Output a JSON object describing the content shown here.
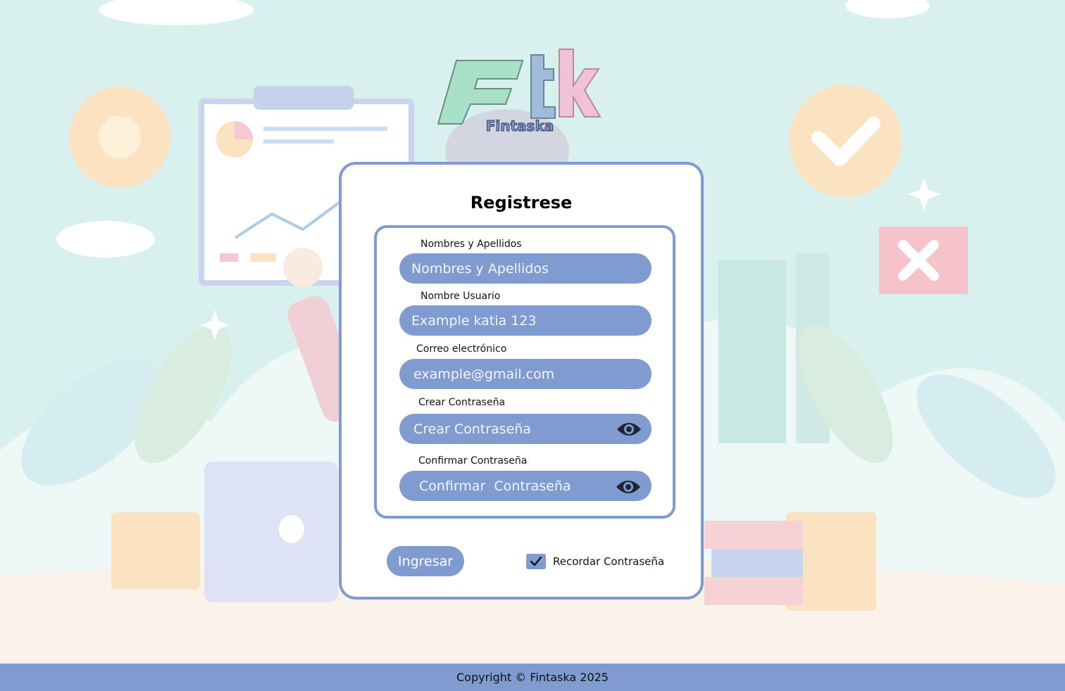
{
  "logo": {
    "brand_text": "Fintaska",
    "letters": "Ftk"
  },
  "card": {
    "title": "Registrese",
    "fields": [
      {
        "label": "Nombres y Apellidos",
        "placeholder": "Nombres y Apellidos",
        "type": "text"
      },
      {
        "label": "Nombre Usuario",
        "placeholder": "Example katia 123",
        "type": "text"
      },
      {
        "label": "Correo electrónico",
        "placeholder": "example@gmail.com",
        "type": "email"
      },
      {
        "label": "Crear Contraseña",
        "placeholder": "Crear Contraseña",
        "type": "password",
        "icon": "eye-icon"
      },
      {
        "label": "Confirmar Contraseña",
        "placeholder": "Confirmar  Contraseña",
        "type": "password",
        "icon": "eye-icon"
      }
    ],
    "submit_label": "Ingresar",
    "remember_label": "Recordar Contraseña",
    "remember_checked": true
  },
  "footer": {
    "copyright": "Copyright © Fintaska 2025"
  },
  "colors": {
    "accent": "#7f9bd0",
    "logo_green": "#a9e0c8",
    "logo_blue": "#9fbcd8",
    "logo_pink": "#efc3d4"
  }
}
